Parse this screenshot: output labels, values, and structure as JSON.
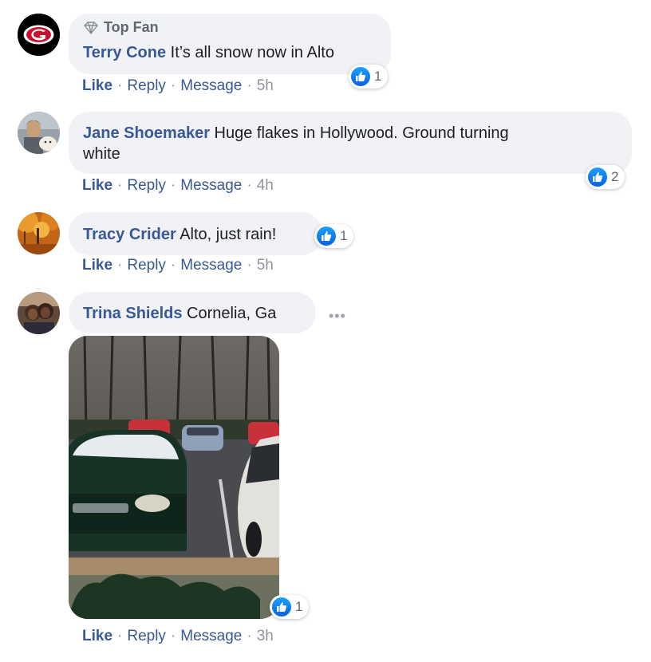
{
  "comments": [
    {
      "author": "Terry Cone",
      "badge": "Top Fan",
      "text": "It’s all snow now in Alto",
      "reaction_count": "1",
      "actions": {
        "like": "Like",
        "reply": "Reply",
        "message": "Message",
        "time": "5h"
      },
      "avatar": "georgia-g-logo"
    },
    {
      "author": "Jane Shoemaker",
      "text_line1": "Huge flakes in Hollywood. Ground turning",
      "text_line2": "white",
      "reaction_count": "2",
      "actions": {
        "like": "Like",
        "reply": "Reply",
        "message": "Message",
        "time": "4h"
      },
      "avatar": "woman-with-dog-photo"
    },
    {
      "author": "Tracy Crider",
      "text": "Alto, just rain!",
      "reaction_count": "1",
      "actions": {
        "like": "Like",
        "reply": "Reply",
        "message": "Message",
        "time": "5h"
      },
      "avatar": "autumn-trees-photo"
    },
    {
      "author": "Trina Shields",
      "text": "Cornelia, Ga",
      "more_label": "•••",
      "reaction_count": "1",
      "actions": {
        "like": "Like",
        "reply": "Reply",
        "message": "Message",
        "time": "3h"
      },
      "avatar": "two-people-photo",
      "attachment": "photo-snow-on-parked-cars"
    }
  ],
  "colors": {
    "author": "#385898",
    "bubble": "#f0f2f5",
    "like_blue": "#1877f2",
    "meta_gray": "#90949c"
  }
}
